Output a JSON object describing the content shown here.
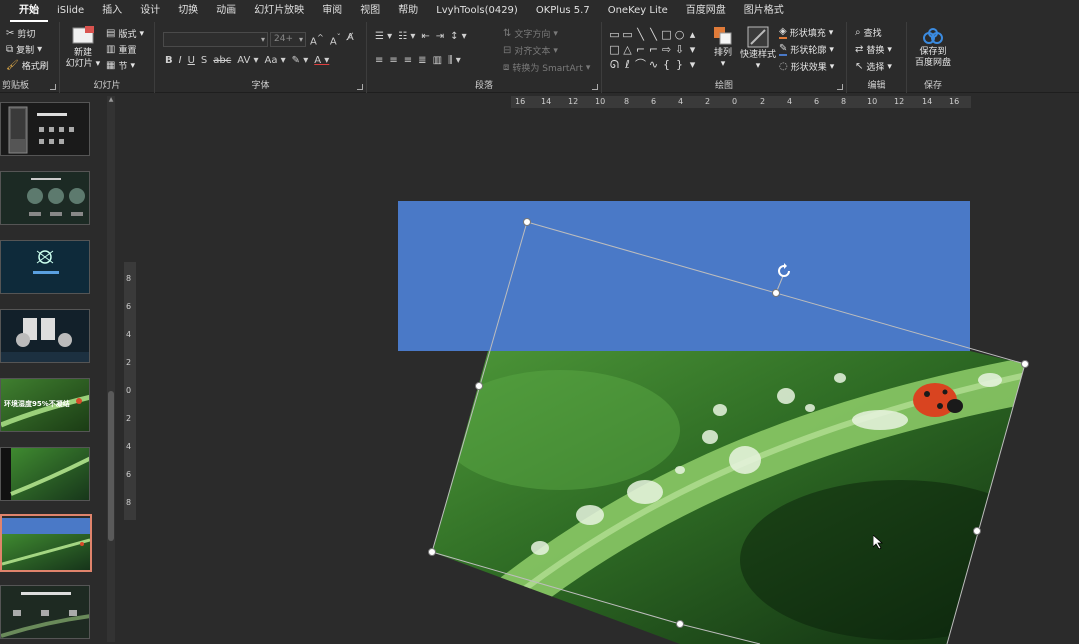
{
  "menu": {
    "tabs": [
      "开始",
      "iSlide",
      "插入",
      "设计",
      "切换",
      "动画",
      "幻灯片放映",
      "审阅",
      "视图",
      "帮助",
      "LvyhTools(0429)",
      "OKPlus 5.7",
      "OneKey Lite",
      "百度网盘",
      "图片格式"
    ],
    "active": "开始"
  },
  "ribbon": {
    "clipboard": {
      "label": "剪贴板",
      "cut": "剪切",
      "copy": "复制",
      "format_painter": "格式刷"
    },
    "slides": {
      "label": "幻灯片",
      "new_slide": "新建",
      "new_slide_2": "幻灯片",
      "layout": "版式",
      "reset": "重置",
      "section": "节"
    },
    "font": {
      "label": "字体",
      "font_name": "",
      "font_size": "24+"
    },
    "paragraph": {
      "label": "段落",
      "text_direction": "文字方向",
      "align_text": "对齐文本",
      "smartart": "转换为 SmartArt"
    },
    "drawing": {
      "label": "绘图",
      "arrange": "排列",
      "quick_styles": "快速样式",
      "shape_fill": "形状填充",
      "shape_outline": "形状轮廓",
      "shape_effects": "形状效果"
    },
    "editing": {
      "label": "编辑",
      "find": "查找",
      "replace": "替换",
      "select": "选择"
    },
    "save": {
      "label": "保存",
      "save_to": "保存到",
      "baidu": "百度网盘"
    }
  },
  "ruler": {
    "horizontal": [
      "16",
      "14",
      "12",
      "10",
      "8",
      "6",
      "4",
      "2",
      "0",
      "2",
      "4",
      "6",
      "8",
      "10",
      "12",
      "14",
      "16"
    ],
    "vertical": [
      "8",
      "6",
      "4",
      "2",
      "0",
      "2",
      "4",
      "6",
      "8"
    ]
  },
  "colors": {
    "background": "#2b2b2b",
    "slide_shape": "#4a79c7",
    "selection_border": "#e0846c",
    "leaf_green": "#4f9a3a"
  },
  "thumbnails": [
    {
      "title": "",
      "selected": false
    },
    {
      "title": "",
      "selected": false
    },
    {
      "title": "",
      "selected": false
    },
    {
      "title": "",
      "selected": false
    },
    {
      "title": "环境湿度95%不凝结",
      "selected": false
    },
    {
      "title": "",
      "selected": false
    },
    {
      "title": "",
      "selected": true
    },
    {
      "title": "",
      "selected": false
    }
  ]
}
